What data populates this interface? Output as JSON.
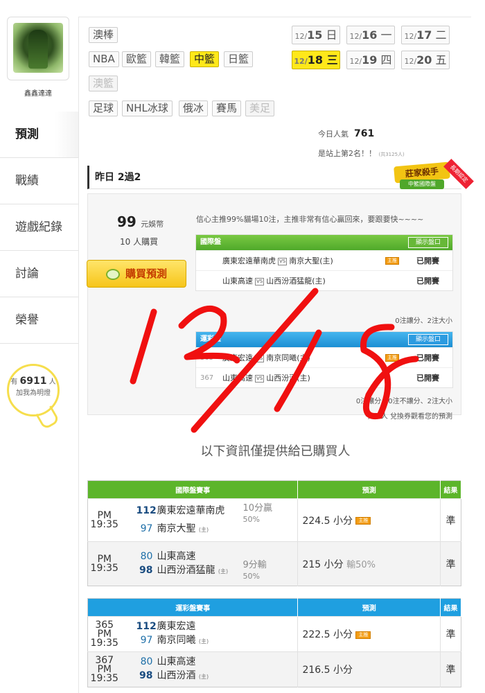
{
  "sidebar": {
    "username": "鑫鑫達達",
    "tabs": [
      "預測",
      "戰績",
      "遊戲紀錄",
      "討論",
      "榮譽"
    ],
    "fans": {
      "prefix": "有",
      "count": "6911",
      "suffix": "人",
      "caption": "加我為明燈"
    }
  },
  "sports": {
    "row1": [
      "澳棒"
    ],
    "row2": [
      "NBA",
      "歐籃",
      "韓籃",
      "中籃",
      "日籃"
    ],
    "row3": [
      "澳籃"
    ],
    "row4": [
      "足球",
      "NHL冰球",
      "俄冰",
      "賽馬",
      "美足"
    ],
    "active": "中籃"
  },
  "dates": [
    {
      "md": "12/",
      "d": "15",
      "wd": "日"
    },
    {
      "md": "12/",
      "d": "16",
      "wd": "一"
    },
    {
      "md": "12/",
      "d": "17",
      "wd": "二"
    },
    {
      "md": "12/",
      "d": "18",
      "wd": "三",
      "active": true
    },
    {
      "md": "12/",
      "d": "19",
      "wd": "四"
    },
    {
      "md": "12/",
      "d": "20",
      "wd": "五"
    }
  ],
  "popularity": {
    "label": "今日人氣",
    "value": "761",
    "rank_text": "是站上第2名！！",
    "rank_sub": "(共3125人)"
  },
  "history": {
    "label": "昨日 2過2"
  },
  "badge": {
    "title": "莊家殺手",
    "sub": "中籃國際盤",
    "ribbon": "長期認定"
  },
  "prediction": {
    "price": "99",
    "price_unit": "元娛幣",
    "buyers": "10",
    "buyers_unit": "人購買",
    "buy_label": "購買預測",
    "note": "信心主推99%貓場10注，主推非常有信心贏回來，要跟要快~~~~",
    "intl": {
      "title": "國際盤",
      "show_label": "顯示盤口",
      "rows": [
        {
          "id": "",
          "away": "廣東宏遠華南虎",
          "home": "南京大聖(主)",
          "tag": "主推",
          "status": "已開賽"
        },
        {
          "id": "",
          "away": "山東高速",
          "home": "山西汾酒猛龍(主)",
          "tag": "",
          "status": "已開賽"
        }
      ],
      "footer": "0注讓分、2注大小"
    },
    "lottery": {
      "title": "運彩盤",
      "show_label": "顯示盤口",
      "rows": [
        {
          "id": "365",
          "away": "廣東宏遠",
          "home": "南京同曦(主)",
          "tag": "主推",
          "status": "已開賽"
        },
        {
          "id": "367",
          "away": "山東高速",
          "home": "山西汾酒(主)",
          "tag": "",
          "status": "已開賽"
        }
      ],
      "footer": "0注讓分、0注不讓分、2注大小",
      "footer2": "今日 人 兌換券觀看您的預測"
    }
  },
  "info_message": "以下資訊僅提供給已購買人",
  "intl_table": {
    "headers": [
      "國際盤賽事",
      "預測",
      "結果"
    ],
    "rows": [
      {
        "time": "PM 19:35",
        "id": "",
        "away_score": "112",
        "away": "廣東宏遠華南虎",
        "home_score": "97",
        "home": "南京大聖",
        "home_tag": "(主)",
        "hc1": "10分贏",
        "hc2": "50%",
        "pred": "224.5 小分",
        "pred_sub": "",
        "tag": "主推",
        "result": "準"
      },
      {
        "time": "PM 19:35",
        "id": "",
        "away_score": "80",
        "away": "山東高速",
        "home_score": "98",
        "home": "山西汾酒猛龍",
        "home_tag": "(主)",
        "hc1": "9分輸",
        "hc2": "50%",
        "pred": "215 小分",
        "pred_sub": "輸50%",
        "tag": "",
        "result": "準"
      }
    ]
  },
  "lottery_table": {
    "headers": [
      "運彩盤賽事",
      "預測",
      "結果"
    ],
    "rows": [
      {
        "time": "PM 19:35",
        "id": "365",
        "away_score": "112",
        "away": "廣東宏遠",
        "home_score": "97",
        "home": "南京同曦",
        "home_tag": "(主)",
        "pred": "222.5 小分",
        "tag": "主推",
        "result": "準"
      },
      {
        "time": "PM 19:35",
        "id": "367",
        "away_score": "80",
        "away": "山東高速",
        "home_score": "98",
        "home": "山西汾酒",
        "home_tag": "(主)",
        "pred": "216.5 小分",
        "tag": "",
        "result": "準"
      }
    ]
  },
  "colors": {
    "accent_yellow": "#ffe81a",
    "green_header": "#5cb52a",
    "blue_header": "#1f9fe0",
    "scribble": "#f01010"
  }
}
